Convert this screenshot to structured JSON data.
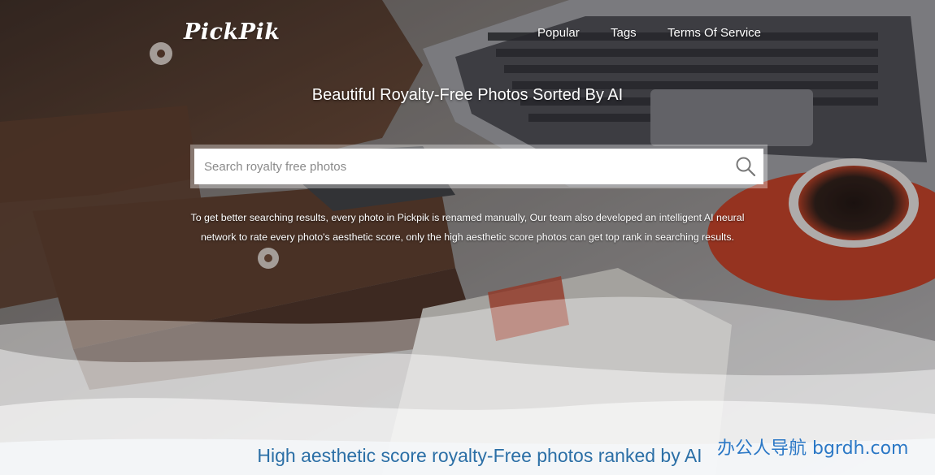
{
  "header": {
    "logo": "PickPik",
    "nav": [
      {
        "label": "Popular"
      },
      {
        "label": "Tags"
      },
      {
        "label": "Terms Of Service"
      }
    ]
  },
  "hero": {
    "headline": "Beautiful Royalty-Free Photos Sorted By AI",
    "search": {
      "placeholder": "Search royalty free photos",
      "value": ""
    },
    "description_line1": "To get better searching results, every photo in Pickpik is renamed manually, Our team also developed an intelligent AI neural",
    "description_line2": "network to rate every photo's aesthetic score, only the high aesthetic score photos can get top rank in searching results."
  },
  "main": {
    "subheading": "High aesthetic score royalty-Free photos ranked by AI"
  },
  "watermark": "办公人导航 bgrdh.com",
  "icons": {
    "search": "search-icon"
  },
  "colors": {
    "subheading": "#2b6fa6",
    "watermark": "#2b78c6"
  }
}
